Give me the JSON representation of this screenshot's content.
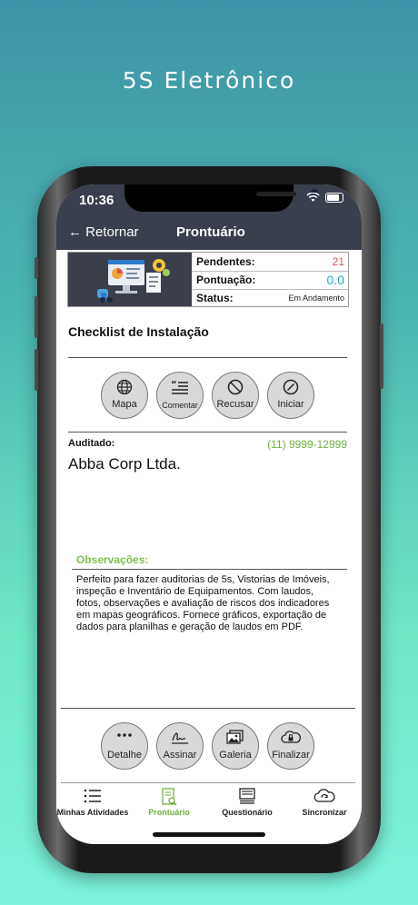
{
  "promo": {
    "title": "5S Eletrônico"
  },
  "status_bar": {
    "time": "10:36"
  },
  "nav": {
    "back_label": "← Retornar",
    "title": "Prontuário"
  },
  "info": {
    "pendentes_label": "Pendentes:",
    "pendentes_value": "21",
    "pontuacao_label": "Pontuação:",
    "pontuacao_value": "0.0",
    "status_label": "Status:",
    "status_value": "Em Andamento"
  },
  "checklist": {
    "title": "Checklist de Instalação"
  },
  "actions_top": [
    {
      "label": "Mapa",
      "icon": "globe-icon"
    },
    {
      "label": "Comentar",
      "icon": "comment-icon"
    },
    {
      "label": "Recusar",
      "icon": "block-icon"
    },
    {
      "label": "Iniciar",
      "icon": "start-icon"
    }
  ],
  "auditado": {
    "label": "Auditado:",
    "phone": "(11) 9999-12999",
    "company": "Abba Corp Ltda."
  },
  "observacoes": {
    "title": "Observações:",
    "text": "Perfeito para fazer auditorias de 5s, Vistorias de Imóveis, inspeção e Inventário de Equipamentos. Com laudos, fotos, observações e avaliação de riscos dos indicadores em mapas geográficos. Fornece gráficos, exportação de dados para planilhas e geração de laudos em PDF."
  },
  "actions_bottom": [
    {
      "label": "Detalhe",
      "icon": "more-icon"
    },
    {
      "label": "Assinar",
      "icon": "signature-icon"
    },
    {
      "label": "Galeria",
      "icon": "gallery-icon"
    },
    {
      "label": "Finalizar",
      "icon": "cloud-lock-icon"
    }
  ],
  "tabs": [
    {
      "label": "Minhas Atividades",
      "icon": "list-icon"
    },
    {
      "label": "Prontuário",
      "icon": "document-search-icon"
    },
    {
      "label": "Questionário",
      "icon": "questionnaire-icon"
    },
    {
      "label": "Sincronizar",
      "icon": "cloud-sync-icon"
    }
  ],
  "colors": {
    "accent_green": "#6db33f",
    "pendentes_red": "#e8505b",
    "pontuacao_blue": "#2a9fd8",
    "header_bg": "#3a3f4d"
  }
}
